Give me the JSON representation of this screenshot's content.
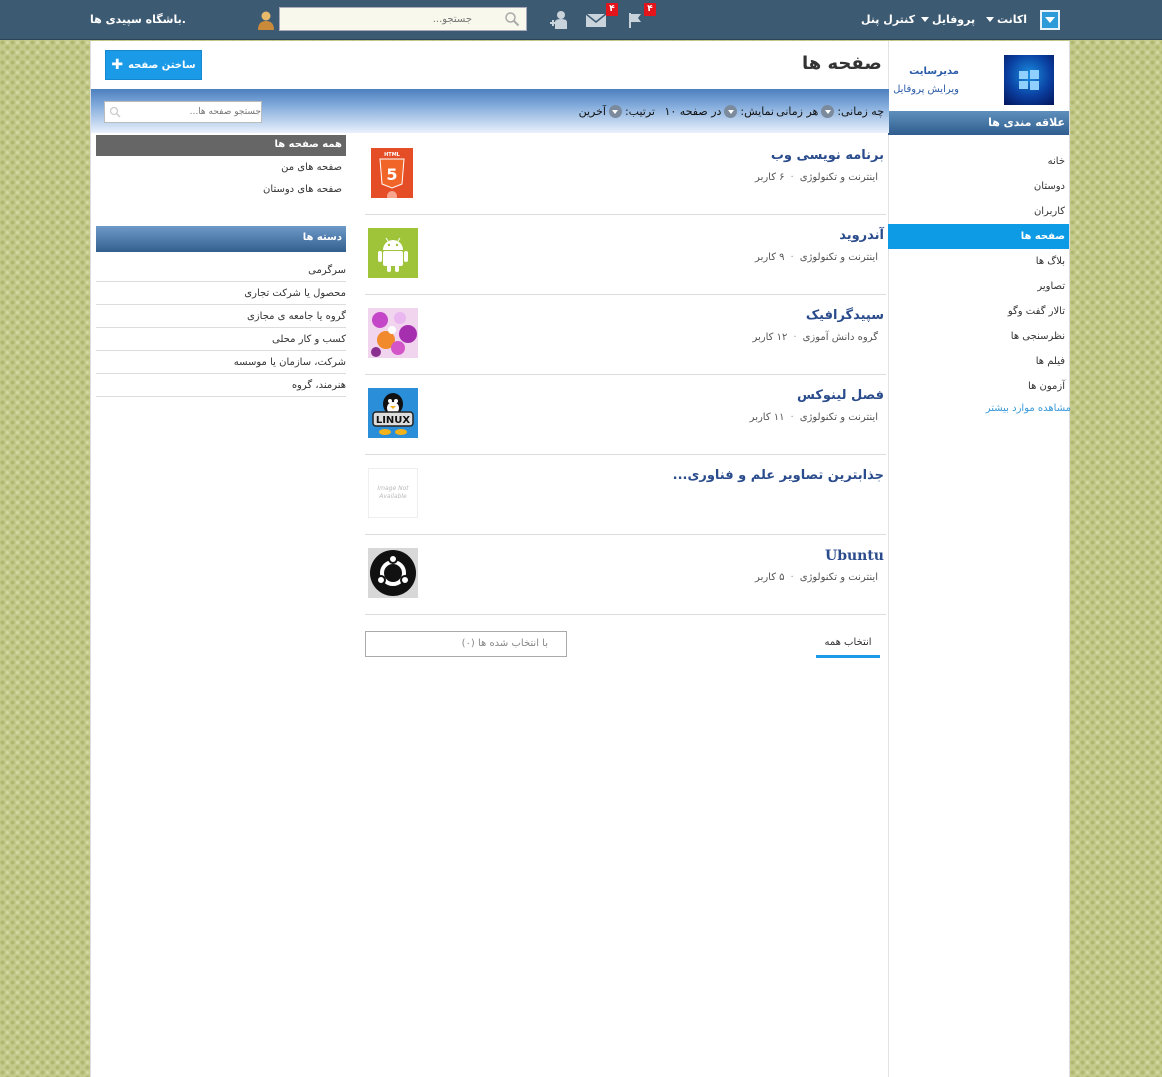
{
  "topbar": {
    "account_label": "اکانت",
    "profile_label": "پروفایل",
    "control_panel_label": "کنترل پنل",
    "search_placeholder": "جستجو...",
    "notifications_count": "۴",
    "messages_count": "۴",
    "site_name": "باشگاه سپیدی ها."
  },
  "sidebar": {
    "profile_name": "مدیرسایت",
    "edit_profile": "ویرایش پروفایل",
    "header": "علاقه مندی ها",
    "items": [
      {
        "label": "خانه"
      },
      {
        "label": "دوستان"
      },
      {
        "label": "کاربران"
      },
      {
        "label": "صفحه ها"
      },
      {
        "label": "بلاگ ها"
      },
      {
        "label": "تصاویر"
      },
      {
        "label": "تالار گفت وگو"
      },
      {
        "label": "نظرسنجی ها"
      },
      {
        "label": "فیلم ها"
      },
      {
        "label": "آزمون ها"
      }
    ],
    "more": "مشاهده موارد بیشتر"
  },
  "header": {
    "title": "صفحه ها",
    "create_button": "ساختن صفحه"
  },
  "filters": {
    "when_label": "چه زمانی:",
    "when_value": "هر زمانی",
    "show_label": "نمایش:",
    "show_value": "در صفحه ۱۰",
    "sort_label": "ترتیب:",
    "sort_value": "آخرین",
    "search_placeholder": "جستجو صفحه ها..."
  },
  "left": {
    "all_pages": "همه صفحه ها",
    "my_pages": "صفحه های من",
    "friends_pages": "صفحه های دوستان",
    "categories_header": "دسته ها",
    "categories": [
      "سرگرمی",
      "محصول یا شرکت تجاری",
      "گروه یا جامعه ی مجازی",
      "کسب و کار محلی",
      "شرکت، سازمان یا موسسه",
      "هنرمند، گروه"
    ]
  },
  "pages": [
    {
      "title": "برنامه نویسی وب",
      "category": "اینترنت و تکنولوژی",
      "members": "۶ کاربر",
      "thumb": "html5-icon"
    },
    {
      "title": "آندروید",
      "category": "اینترنت و تکنولوژی",
      "members": "۹ کاربر",
      "thumb": "android-icon"
    },
    {
      "title": "سپیدگرافیک",
      "category": "گروه دانش آموزی",
      "members": "۱۲ کاربر",
      "thumb": "flowers-image"
    },
    {
      "title": "فصل لینوکس",
      "category": "اینترنت و تکنولوژی",
      "members": "۱۱ کاربر",
      "thumb": "linux-tux-icon"
    },
    {
      "title": "جذابترین تصاویر علم و فناوری...",
      "category": "",
      "members": "",
      "thumb": "image-not-available",
      "thumb_text": "Image Not Available"
    },
    {
      "title": "Ubuntu",
      "category": "اینترنت و تکنولوژی",
      "members": "۵ کاربر",
      "thumb": "ubuntu-icon"
    }
  ],
  "footer": {
    "bulk_select": "با انتخاب شده ها (۰)",
    "select_all": "انتخاب همه"
  },
  "colors": {
    "topbar": "#3d5a73",
    "accent": "#1b9ae8",
    "title_link": "#2b4c8c",
    "badge": "#e4141b"
  }
}
